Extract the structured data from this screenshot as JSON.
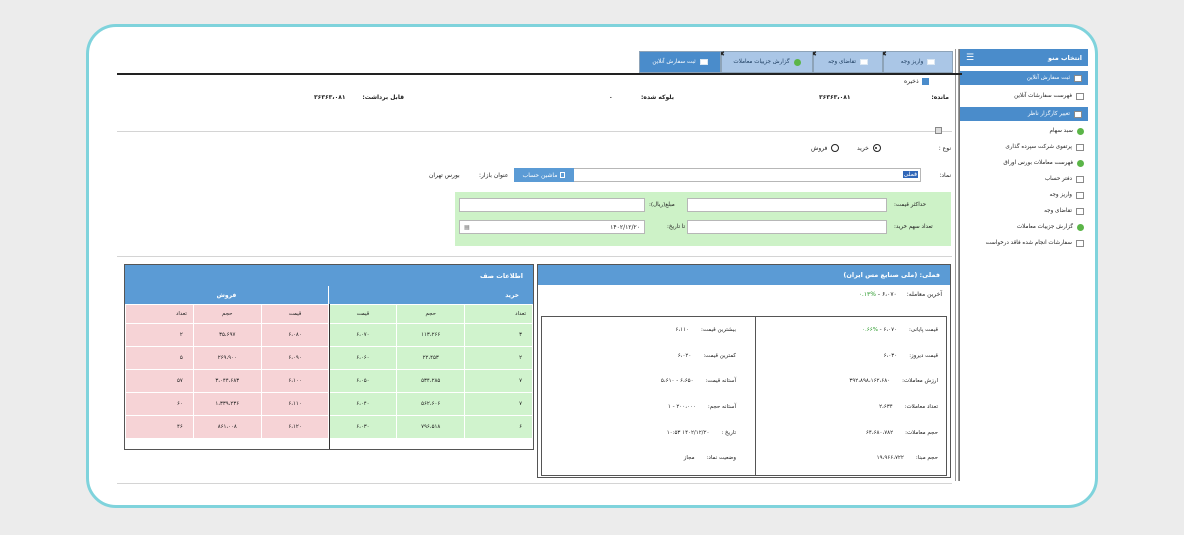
{
  "sidebar": {
    "title": "انتخاب منو",
    "items": [
      {
        "label": "ثبت سفارش آنلاین",
        "icon": "document-icon",
        "selected": true
      },
      {
        "label": "فهرست سفارشات آنلاین",
        "icon": "document-icon"
      },
      {
        "label": "تغییر کارگزار ناظر",
        "icon": "document-icon",
        "selected": true
      },
      {
        "label": "سبد سهام",
        "icon": "check-icon"
      },
      {
        "label": "پرتفوی شرکت سپرده گذاری",
        "icon": "document-icon"
      },
      {
        "label": "فهرست معاملات بورس اوراق",
        "icon": "check-icon"
      },
      {
        "label": "دفتر حساب",
        "icon": "document-icon"
      },
      {
        "label": "واریز وجه",
        "icon": "document-icon"
      },
      {
        "label": "تقاضای وجه",
        "icon": "document-icon"
      },
      {
        "label": "گزارش جزییات معاملات",
        "icon": "check-icon"
      },
      {
        "label": "سفارشات انجام شده فاقد درخواست",
        "icon": "document-icon"
      }
    ]
  },
  "tabs": [
    {
      "label": "واریز وجه"
    },
    {
      "label": "تقاضای وجه"
    },
    {
      "label": "گزارش جزییات معاملات"
    },
    {
      "label": "ثبت سفارش آنلاین"
    }
  ],
  "header": {
    "save": "ذخیره",
    "remain_label": "مانده:",
    "remain_value": "۳۶۳۶۳،۰۸۱",
    "blocked_label": "بلوکه شده:",
    "blocked_value": "۰",
    "withdraw_label": "قابل برداشت:",
    "withdraw_value": "۳۶۳۶۳،۰۸۱"
  },
  "form": {
    "type_label": "نوع :",
    "buy": "خرید",
    "sell": "فروش",
    "symbol_label": "نماد:",
    "symbol_value": "فملی",
    "account_button": "ماشین حساب",
    "market_label": "عنوان بازار:",
    "market_value": "بورس تهران",
    "max_price_label": "حداکثر قیمت:",
    "amount_label": "مبلغ(ریال):",
    "shares_label": "تعداد سهم خرید:",
    "until_label": "تا تاریخ:",
    "date_value": "۱۴۰۲/۱۲/۲۰"
  },
  "queue": {
    "title": "اطلاعات صف",
    "buy": "خرید",
    "sell": "فروش",
    "cols_buy": [
      "تعداد",
      "حجم",
      "قیمت"
    ],
    "cols_sell": [
      "قیمت",
      "حجم",
      "تعداد"
    ],
    "rows": [
      {
        "b_count": "۳",
        "b_vol": "۱۱۳،۲۶۶",
        "b_price": "۶،۰۷۰",
        "s_price": "۶،۰۸۰",
        "s_vol": "۳۵،۶۹۷",
        "s_count": "۲"
      },
      {
        "b_count": "۲",
        "b_vol": "۲۲،۴۵۳",
        "b_price": "۶،۰۶۰",
        "s_price": "۶،۰۹۰",
        "s_vol": "۲۶۹،۹۰۰",
        "s_count": "۵"
      },
      {
        "b_count": "۷",
        "b_vol": "۵۳۴،۲۸۵",
        "b_price": "۶،۰۵۰",
        "s_price": "۶،۱۰۰",
        "s_vol": "۳،۰۴۴،۶۸۳",
        "s_count": "۵۷"
      },
      {
        "b_count": "۷",
        "b_vol": "۵۶۲،۶۰۶",
        "b_price": "۶،۰۴۰",
        "s_price": "۶،۱۱۰",
        "s_vol": "۱،۳۳۹،۲۳۶",
        "s_count": "۶۰"
      },
      {
        "b_count": "۶",
        "b_vol": "۷۹۶،۵۱۸",
        "b_price": "۶،۰۳۰",
        "s_price": "۶،۱۲۰",
        "s_vol": "۸۶۱،۰۰۸",
        "s_count": "۴۶"
      }
    ]
  },
  "info": {
    "title": "فملی: (ملی صنایع مس ایران)",
    "last_trade_label": "آخرین معامله:",
    "last_trade_value": "۶،۰۷۰ - ",
    "last_trade_change": "۰.۱۳%",
    "rows_right": [
      {
        "label": "قیمت پایانی:",
        "value": "۶،۰۷۰ - ",
        "extra": "۰.۶۶%"
      },
      {
        "label": "قیمت دیروز:",
        "value": "۶،۰۳۰"
      },
      {
        "label": "ارزش معاملات:",
        "value": "۳۹۲،۸۹۸،۱۶۲،۶۸۰"
      },
      {
        "label": "تعداد معاملات:",
        "value": "۲،۶۳۴"
      },
      {
        "label": "حجم معاملات:",
        "value": "۶۴،۶۸۰،۷۸۲"
      },
      {
        "label": "حجم مبنا:",
        "value": "۱۹،۹۶۶،۷۲۲"
      }
    ],
    "rows_left": [
      {
        "label": "بیشترین قیمت:",
        "value": "۶،۱۱۰"
      },
      {
        "label": "کمترین قیمت:",
        "value": "۶،۰۲۰"
      },
      {
        "label": "آستانه قیمت:",
        "value": "۶،۶۵۰ - ۵،۶۱۰"
      },
      {
        "label": "آستانه حجم:",
        "value": "۲۰۰،۰۰۰ - ۱"
      },
      {
        "label": "تاریخ :",
        "value": "۱۴۰۲/۱۲/۲۰ ۱۰:۵۳"
      },
      {
        "label": "وضعیت نماد:",
        "value": "مجاز"
      }
    ]
  },
  "colors": {
    "accent": "#4a8ccb",
    "panel_header": "#5b9bd5",
    "buy_bg": "#d0f3cd",
    "sell_bg": "#f6d3d6",
    "frame": "#7fd3dc"
  }
}
